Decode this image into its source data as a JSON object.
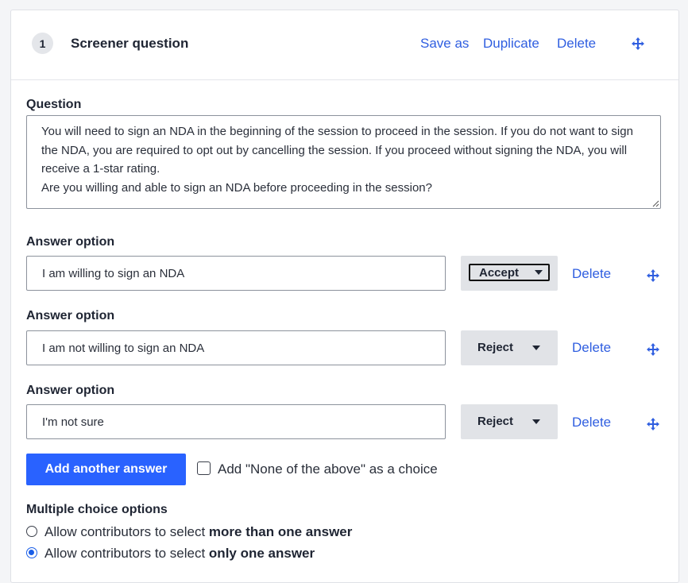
{
  "header": {
    "number": "1",
    "title": "Screener question",
    "save_as": "Save as",
    "duplicate": "Duplicate",
    "delete": "Delete",
    "move_icon": "move-arrows-icon"
  },
  "question": {
    "label": "Question",
    "text": "You will need to sign an NDA in the beginning of the session to proceed in the session. If you do not want to sign the NDA, you are required to opt out by cancelling the session. If you proceed without signing the NDA, you will receive a 1-star rating.\nAre you willing and able to sign an NDA before proceeding in the session?"
  },
  "answers": [
    {
      "label": "Answer option",
      "value": "I am willing to sign an NDA",
      "outcome": "Accept",
      "delete": "Delete"
    },
    {
      "label": "Answer option",
      "value": "I am not willing to sign an NDA",
      "outcome": "Reject",
      "delete": "Delete"
    },
    {
      "label": "Answer option",
      "value": "I'm not sure",
      "outcome": "Reject",
      "delete": "Delete"
    }
  ],
  "add_answer_button": "Add another answer",
  "none_of_above": {
    "label": "Add \"None of the above\" as a choice",
    "checked": false
  },
  "multiple_choice": {
    "label": "Multiple choice options",
    "options": [
      {
        "prefix": "Allow contributors to select ",
        "emphasis": "more than one answer",
        "checked": false
      },
      {
        "prefix": "Allow contributors to select ",
        "emphasis": "only one answer",
        "checked": true
      }
    ]
  },
  "colors": {
    "accent": "#2962ff",
    "link": "#2f5ee0",
    "radio_selected": "#1a5ee8"
  }
}
